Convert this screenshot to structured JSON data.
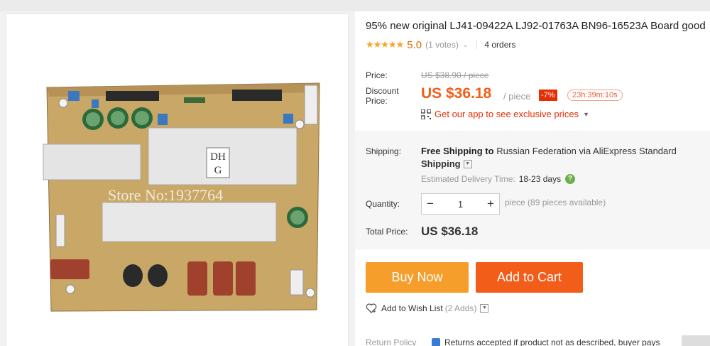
{
  "product": {
    "title": "95% new original LJ41-09422A LJ92-01763A BN96-16523A Board good",
    "stars": "★★★★★",
    "rating": "5.0",
    "votes": "(1 votes)",
    "orders": "4 orders"
  },
  "image": {
    "watermark": "Store No:1937764",
    "label_text": "DH G"
  },
  "pricing": {
    "price_label": "Price:",
    "original_price": "US $38.90 / piece",
    "discount_label_1": "Discount",
    "discount_label_2": "Price:",
    "discount_price": "US $36.18",
    "per_piece": "/ piece",
    "discount_badge": "-7%",
    "countdown": "23h:39m:10s",
    "app_promo": "Get our app to see exclusive prices"
  },
  "shipping": {
    "label": "Shipping:",
    "free_shipping": "Free Shipping to",
    "destination": "Russian Federation via AliExpress Standard",
    "line2": "Shipping",
    "eta_label": "Estimated Delivery Time:",
    "eta_value": "18-23 days"
  },
  "quantity": {
    "label": "Quantity:",
    "value": "1",
    "minus": "−",
    "plus": "+",
    "info": "piece (89 pieces available)"
  },
  "total": {
    "label": "Total Price:",
    "value": "US $36.18"
  },
  "actions": {
    "buy_now": "Buy Now",
    "add_to_cart": "Add to Cart",
    "wishlist": "Add to Wish List",
    "wishlist_count": "(2 Adds)"
  },
  "returns": {
    "label": "Return Policy",
    "text": "Returns accepted if product not as described, buyer pays"
  },
  "colors": {
    "price_accent": "#f25d19",
    "buy_now": "#f59e2c",
    "add_to_cart": "#f25d19",
    "badge_red": "#e62e04",
    "star": "#f5a623"
  }
}
